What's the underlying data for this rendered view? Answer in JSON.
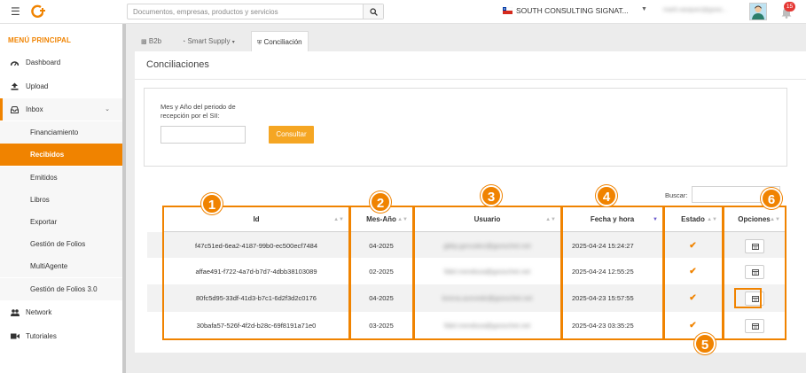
{
  "header": {
    "search_placeholder": "Documentos, empresas, productos y servicios",
    "company": "SOUTH CONSULTING SIGNAT...",
    "user_email": "martl.vasquez@gooo...",
    "notifications": "15"
  },
  "sidebar": {
    "title": "MENÚ PRINCIPAL",
    "items": [
      {
        "label": "Dashboard",
        "icon": "dashboard-icon"
      },
      {
        "label": "Upload",
        "icon": "upload-icon"
      },
      {
        "label": "Inbox",
        "icon": "inbox-icon"
      },
      {
        "label": "Financiamiento"
      },
      {
        "label": "Recibidos"
      },
      {
        "label": "Emitidos"
      },
      {
        "label": "Libros"
      },
      {
        "label": "Exportar"
      },
      {
        "label": "Gestión de Folios"
      },
      {
        "label": "MultiAgente"
      },
      {
        "label": "Gestión de Folios 3.0"
      },
      {
        "label": "Network",
        "icon": "network-icon"
      },
      {
        "label": "Tutoriales",
        "icon": "video-icon"
      }
    ]
  },
  "tabs": [
    {
      "label": "B2b"
    },
    {
      "label": "Smart Supply"
    },
    {
      "label": "Conciliación"
    }
  ],
  "page": {
    "title": "Conciliaciones",
    "form_label": "Mes y Año del periodo de recepción por el SII:",
    "consult_button": "Consultar",
    "search_label": "Buscar:"
  },
  "table": {
    "headers": [
      "Id",
      "Mes-Año",
      "Usuario",
      "Fecha y hora",
      "Estado",
      "Opciones"
    ],
    "rows": [
      {
        "id": "f47c51ed-6ea2-4187-99b0-ec500ecf7484",
        "mes": "04-2025",
        "user": "gbby.gonzalez@gooschet.net",
        "fecha": "2025-04-24 15:24:27"
      },
      {
        "id": "affae491-f722-4a7d-b7d7-4dbb38103089",
        "mes": "02-2025",
        "user": "fidel.mendoza@gooschet.net",
        "fecha": "2025-04-24 12:55:25"
      },
      {
        "id": "80fc5d95-33df-41d3-b7c1-6d2f3d2c0176",
        "mes": "04-2025",
        "user": "lorena.acevedo@gooschet.net",
        "fecha": "2025-04-23 15:57:55"
      },
      {
        "id": "30bafa57-526f-4f2d-b28c-69f8191a71e0",
        "mes": "03-2025",
        "user": "fidel.mendoza@gooschet.net",
        "fecha": "2025-04-23 03:35:25"
      }
    ]
  },
  "annotations": [
    "1",
    "2",
    "3",
    "4",
    "5",
    "6"
  ],
  "colors": {
    "accent": "#f08300",
    "button": "#f5a623"
  }
}
